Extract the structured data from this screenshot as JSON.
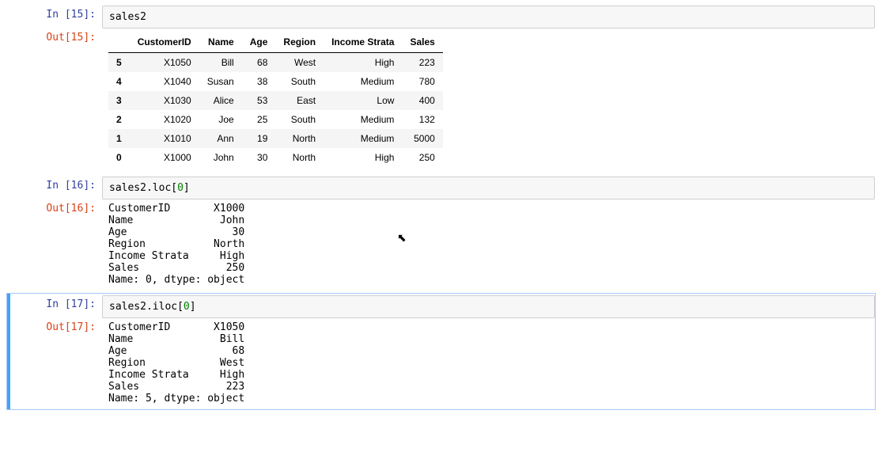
{
  "cells": [
    {
      "in_num": 15,
      "in_label": "In [15]:",
      "out_label": "Out[15]:",
      "code_prefix": "sales2",
      "code_num": "",
      "code_suffix": "",
      "table": {
        "columns": [
          "",
          "CustomerID",
          "Name",
          "Age",
          "Region",
          "Income Strata",
          "Sales"
        ],
        "rows": [
          {
            "idx": "5",
            "cells": [
              "X1050",
              "Bill",
              "68",
              "West",
              "High",
              "223"
            ]
          },
          {
            "idx": "4",
            "cells": [
              "X1040",
              "Susan",
              "38",
              "South",
              "Medium",
              "780"
            ]
          },
          {
            "idx": "3",
            "cells": [
              "X1030",
              "Alice",
              "53",
              "East",
              "Low",
              "400"
            ]
          },
          {
            "idx": "2",
            "cells": [
              "X1020",
              "Joe",
              "25",
              "South",
              "Medium",
              "132"
            ]
          },
          {
            "idx": "1",
            "cells": [
              "X1010",
              "Ann",
              "19",
              "North",
              "Medium",
              "5000"
            ]
          },
          {
            "idx": "0",
            "cells": [
              "X1000",
              "John",
              "30",
              "North",
              "High",
              "250"
            ]
          }
        ]
      }
    },
    {
      "in_num": 16,
      "in_label": "In [16]:",
      "out_label": "Out[16]:",
      "code_prefix": "sales2.loc[",
      "code_num": "0",
      "code_suffix": "]",
      "text_output": "CustomerID       X1000\nName              John\nAge                 30\nRegion           North\nIncome Strata     High\nSales              250\nName: 0, dtype: object"
    },
    {
      "in_num": 17,
      "in_label": "In [17]:",
      "out_label": "Out[17]:",
      "code_prefix": "sales2.iloc[",
      "code_num": "0",
      "code_suffix": "]",
      "text_output": "CustomerID       X1050\nName              Bill\nAge                 68\nRegion            West\nIncome Strata     High\nSales              223\nName: 5, dtype: object",
      "selected": true
    }
  ],
  "cursor_glyph": "⬉"
}
